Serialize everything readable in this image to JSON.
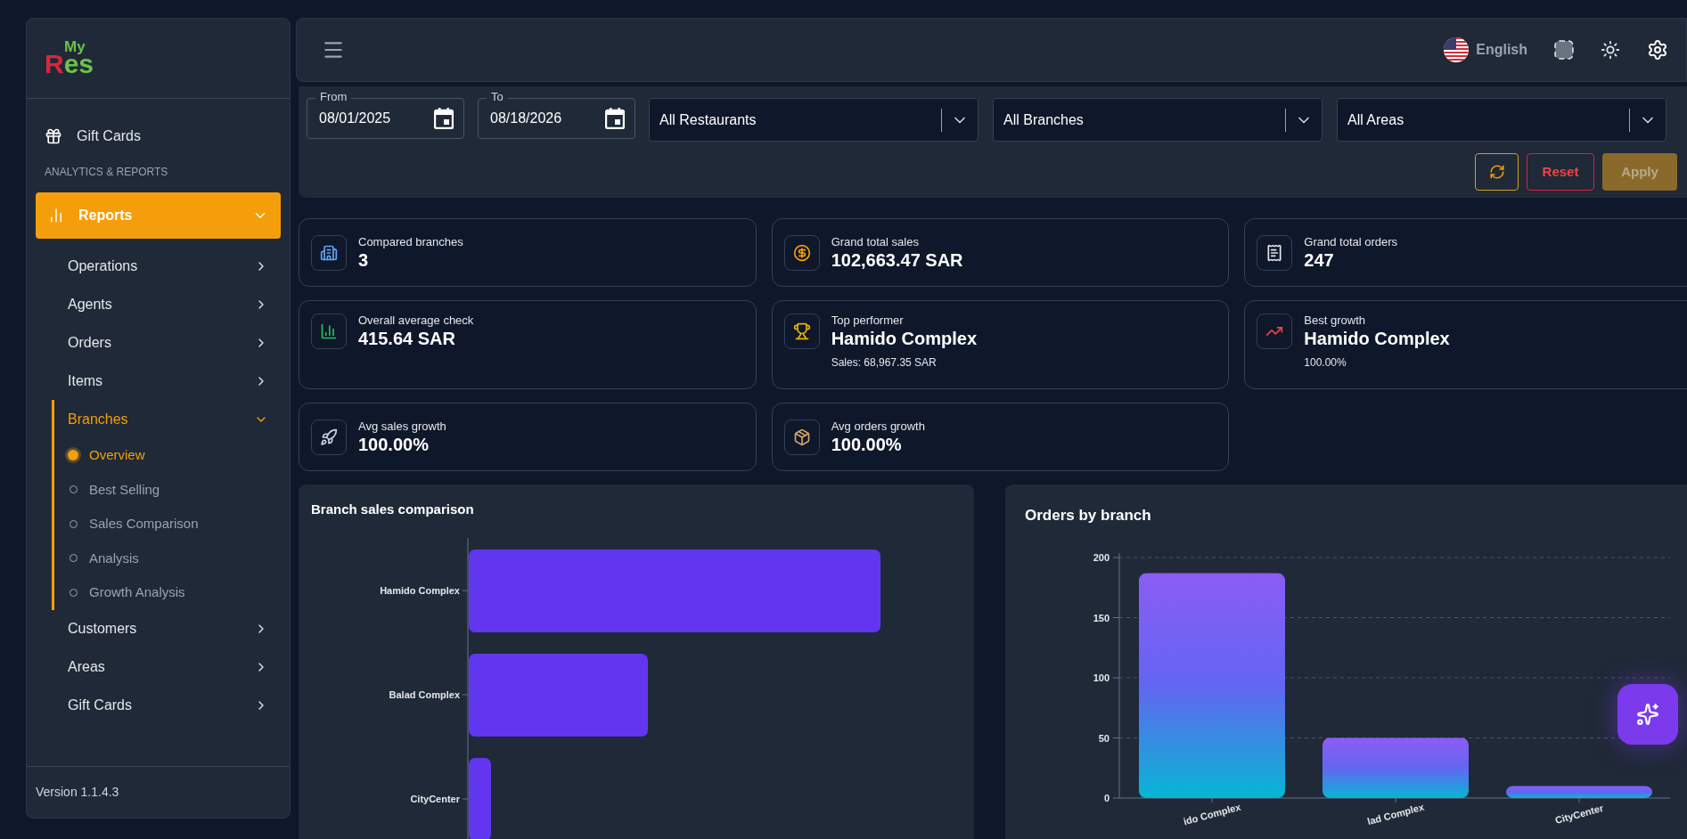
{
  "sidebar": {
    "logo": {
      "top": "My",
      "initial": "R",
      "rest": "es"
    },
    "items": [
      {
        "label": "Gift Cards",
        "kind": "link"
      }
    ],
    "section": "ANALYTICS & REPORTS",
    "group": {
      "label": "Reports",
      "expanded": true,
      "children": [
        {
          "label": "Operations",
          "expanded": false
        },
        {
          "label": "Agents",
          "expanded": false
        },
        {
          "label": "Orders",
          "expanded": false
        },
        {
          "label": "Items",
          "expanded": false
        },
        {
          "label": "Branches",
          "expanded": true,
          "children": [
            {
              "label": "Overview",
              "selected": true
            },
            {
              "label": "Best Selling",
              "selected": false
            },
            {
              "label": "Sales Comparison",
              "selected": false
            },
            {
              "label": "Analysis",
              "selected": false
            },
            {
              "label": "Growth Analysis",
              "selected": false
            }
          ]
        },
        {
          "label": "Customers",
          "expanded": false
        },
        {
          "label": "Areas",
          "expanded": false
        },
        {
          "label": "Gift Cards",
          "expanded": false
        }
      ]
    },
    "version": "Version 1.1.4.3"
  },
  "top_bar": {
    "language": "English"
  },
  "filters": {
    "dates": [
      {
        "label": "From",
        "value": "08/01/2025"
      },
      {
        "label": "To",
        "value": "08/18/2026"
      }
    ],
    "selects": [
      "All Restaurants",
      "All Branches",
      "All Areas"
    ],
    "reset": "Reset",
    "apply": {
      "label": "Apply",
      "disabled": true
    }
  },
  "cards": [
    {
      "kind": "building",
      "title": "Compared branches",
      "value": "3"
    },
    {
      "kind": "money",
      "title": "Grand total sales",
      "value": "102,663.47 SAR"
    },
    {
      "kind": "receipt",
      "title": "Grand total orders",
      "value": "247"
    },
    {
      "kind": "bars",
      "title": "Overall average check",
      "value": "415.64 SAR"
    },
    {
      "kind": "trophy",
      "title": "Top performer",
      "value": "Hamido Complex",
      "sub": "Sales: 68,967.35 SAR"
    },
    {
      "kind": "growth",
      "title": "Best growth",
      "value": "Hamido Complex",
      "sub": "100.00%"
    },
    {
      "kind": "rocket",
      "title": "Avg sales growth",
      "value": "100.00%"
    },
    {
      "kind": "package",
      "title": "Avg orders growth",
      "value": "100.00%"
    }
  ],
  "branch_sales": {
    "title": "Branch sales comparison",
    "bar_labels": [
      "Hamido Complex",
      "Balad Complex",
      "CityCenter"
    ]
  },
  "orders_chart": {
    "chart_data": {
      "type": "bar",
      "title": "Orders by branch",
      "categories": [
        "ido Complex",
        "lad Complex",
        "CityCenter"
      ],
      "values": [
        187,
        50,
        10
      ],
      "ylim": [
        0,
        200
      ],
      "yticks": [
        0,
        50,
        100,
        150,
        200
      ],
      "grid": true
    }
  }
}
